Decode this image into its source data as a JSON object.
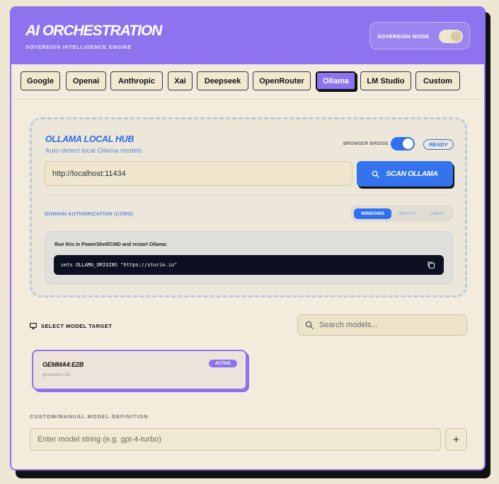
{
  "header": {
    "title": "AI ORCHESTRATION",
    "subtitle": "SOVEREIGN INTELLIGENCE ENGINE",
    "mode_label": "SOVEREIGN MODE",
    "mode_on": true
  },
  "providers": {
    "tabs": [
      {
        "label": "Google"
      },
      {
        "label": "Openai"
      },
      {
        "label": "Anthropic"
      },
      {
        "label": "Xai"
      },
      {
        "label": "Deepseek"
      },
      {
        "label": "OpenRouter"
      },
      {
        "label": "Ollama"
      },
      {
        "label": "LM Studio"
      },
      {
        "label": "Custom"
      }
    ],
    "active": "Ollama"
  },
  "hub": {
    "title": "OLLAMA LOCAL HUB",
    "subtitle": "Auto-detect local Ollama models",
    "bridge_label": "BROWSER BRIDGE",
    "bridge_on": true,
    "status": "READY",
    "url_value": "http://localhost:11434",
    "scan_label": "SCAN OLLAMA",
    "cors_label": "DOMAIN AUTHORIZATION (CORS)",
    "os_options": [
      {
        "label": "WINDOWS"
      },
      {
        "label": "MACOS"
      },
      {
        "label": "LINUX"
      }
    ],
    "os_selected": "WINDOWS",
    "instruction": "Run this in PowerShell/CMD and restart Ollama:",
    "command": "setx OLLAMA_ORIGINS \"https://sturio.io\""
  },
  "models": {
    "section_label": "SELECT MODEL TARGET",
    "search_placeholder": "Search models...",
    "items": [
      {
        "name": "GEMMA4:E2B",
        "id": "gemma4:e2b",
        "badge": "ACTIVE"
      }
    ]
  },
  "custom": {
    "label": "CUSTOM/MANUAL MODEL DEFINITION",
    "placeholder": "Enter model string (e.g. gpt-4-turbo)",
    "add_label": "+"
  },
  "colors": {
    "accent": "#8d74ee",
    "primary_blue": "#2f6ff0",
    "background": "#f3ecdc"
  },
  "icons": [
    "search-icon",
    "monitor-icon",
    "copy-icon",
    "plus-icon"
  ]
}
